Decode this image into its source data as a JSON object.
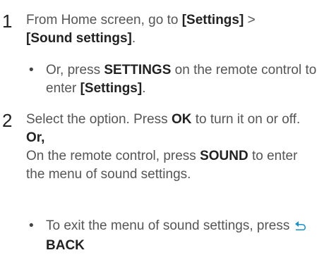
{
  "step1": {
    "number": "1",
    "text_before": "From Home screen, go to ",
    "settings": "[Settings]",
    "sep": " > ",
    "sound_settings": "[Sound settings]",
    "suffix": ".",
    "bullet": {
      "text_before": "Or, press ",
      "key": "SETTINGS",
      "text_mid": " on the remote control to enter ",
      "settings": "[Settings]",
      "suffix": "."
    }
  },
  "step2": {
    "number": "2",
    "text_before": "Select the option. Press ",
    "key": "OK",
    "text_after": " to turn it on or off.",
    "or_label": "Or,",
    "alt_before": "On the remote control, press ",
    "alt_key": "SOUND",
    "alt_after": " to enter the menu of sound settings.",
    "bullet": {
      "text_before": "To exit the menu of sound settings, press ",
      "key": "BACK",
      "icon": "back-arrow-icon",
      "icon_color": "#1a8fc9"
    }
  }
}
